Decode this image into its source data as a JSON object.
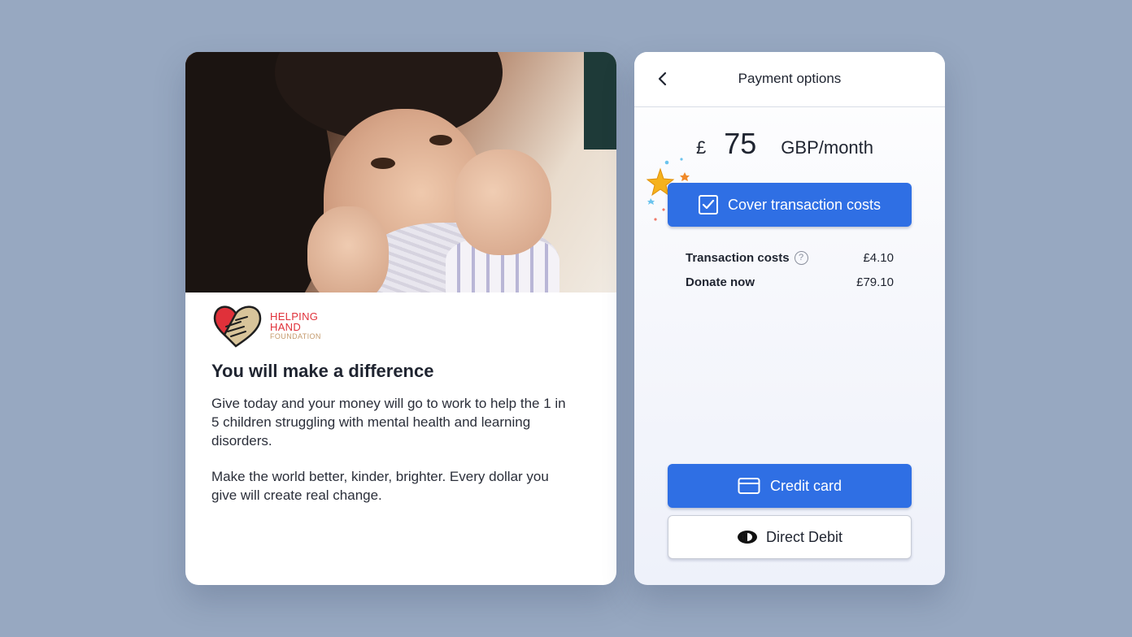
{
  "left_card": {
    "hero_alt": "Child holding sweater",
    "logo": {
      "line1": "HELPING",
      "line2": "HAND",
      "line3": "FOUNDATION",
      "icon": "heart-handshake-icon"
    },
    "headline": "You will make a difference",
    "paragraph1": "Give today and your money will go to work to help the 1 in 5 children struggling with mental health and learning disorders.",
    "paragraph2": "Make the world better, kinder, brighter. Every dollar you give will create real change."
  },
  "right_card": {
    "header": {
      "title": "Payment options",
      "back_icon": "chevron-left-icon"
    },
    "amount": {
      "currency": "£",
      "value": "75",
      "unit": "GBP/month"
    },
    "cover_button": {
      "label": "Cover transaction costs",
      "checked": true
    },
    "summary": [
      {
        "label": "Transaction costs",
        "value": "£4.10",
        "has_help": true
      },
      {
        "label": "Donate now",
        "value": "£79.10",
        "has_help": false
      }
    ],
    "credit_button": {
      "label": "Credit card",
      "icon": "credit-card-icon"
    },
    "debit_button": {
      "label": "Direct Debit",
      "icon": "direct-debit-icon"
    }
  },
  "colors": {
    "background": "#97a8c1",
    "primary": "#2f6fe4",
    "logo_red": "#e0313a",
    "logo_tan": "#c49a6c"
  }
}
